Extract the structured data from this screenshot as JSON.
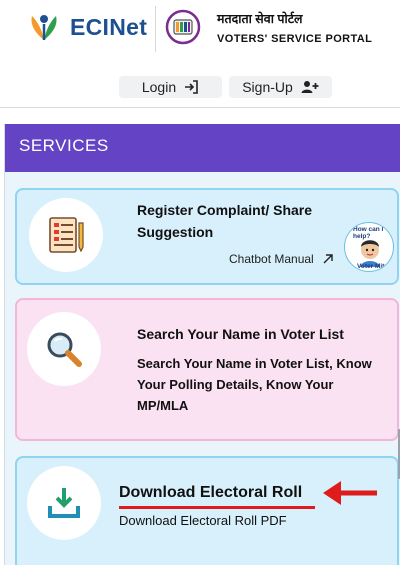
{
  "header": {
    "brand": "ECINet",
    "portal_hindi": "मतदाता सेवा पोर्टल",
    "portal_english": "VOTERS' SERVICE PORTAL"
  },
  "auth": {
    "login_label": "Login",
    "signup_label": "Sign-Up"
  },
  "services": {
    "title": "SERVICES",
    "cards": [
      {
        "title": "Register Complaint/ Share Suggestion",
        "link_label": "Chatbot Manual",
        "icon": "form-document-icon",
        "mascot_top_text": "How can I help?",
        "mascot_bottom_text": "Voter Mitra"
      },
      {
        "title": "Search Your Name in Voter List",
        "description": "Search Your Name in Voter List, Know Your Polling Details, Know Your MP/MLA",
        "icon": "magnifier-icon"
      },
      {
        "title": "Download Electoral Roll",
        "subtitle": "Download Electoral Roll PDF",
        "icon": "download-icon"
      }
    ]
  },
  "colors": {
    "brand_blue": "#1d4f91",
    "services_header": "#6444c4",
    "card_blue_bg": "#d7f0fb",
    "card_pink_bg": "#fbe2f2",
    "annotation_red": "#e01b1b"
  }
}
